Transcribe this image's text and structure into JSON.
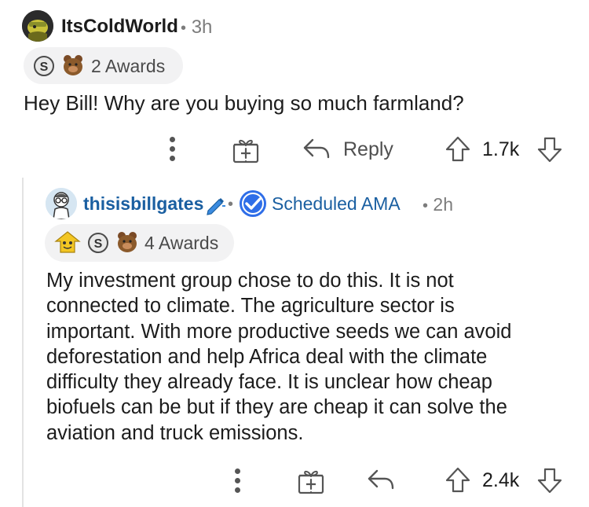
{
  "comment1": {
    "username": "ItsColdWorld",
    "separator": "•",
    "time": "3h",
    "awards_label": "2 Awards",
    "body": "Hey Bill! Why are you buying so much farmland?",
    "reply_label": "Reply",
    "score": "1.7k"
  },
  "comment2": {
    "username": "thisisbillgates",
    "separator": "•",
    "flair": "Scheduled AMA",
    "separator2": "•",
    "time": "2h",
    "awards_label": "4 Awards",
    "body_lines": [
      "My investment group chose to do this. It is not",
      "connected to climate. The agriculture sector is",
      "important. With more productive seeds we can avoid",
      "deforestation and help Africa deal with the climate",
      "difficulty they already face. It is unclear how cheap",
      "biofuels can be but if they are cheap it can solve the",
      "aviation and truck emissions."
    ],
    "score": "2.4k"
  },
  "colors": {
    "username_link": "#1a5fa1",
    "verified_badge": "#2f6ee8",
    "text": "#1c1c1c",
    "meta": "#7c7c7c",
    "award_pill": "#f2f2f3"
  },
  "icons": [
    "avatar-itscoldworld",
    "silver-award-icon",
    "bear-award-icon",
    "more-options-icon",
    "gift-award-icon",
    "reply-arrow-icon",
    "upvote-icon",
    "downvote-icon",
    "avatar-thisisbillgates",
    "pencil-icon",
    "verified-check-icon",
    "helpful-award-icon"
  ]
}
